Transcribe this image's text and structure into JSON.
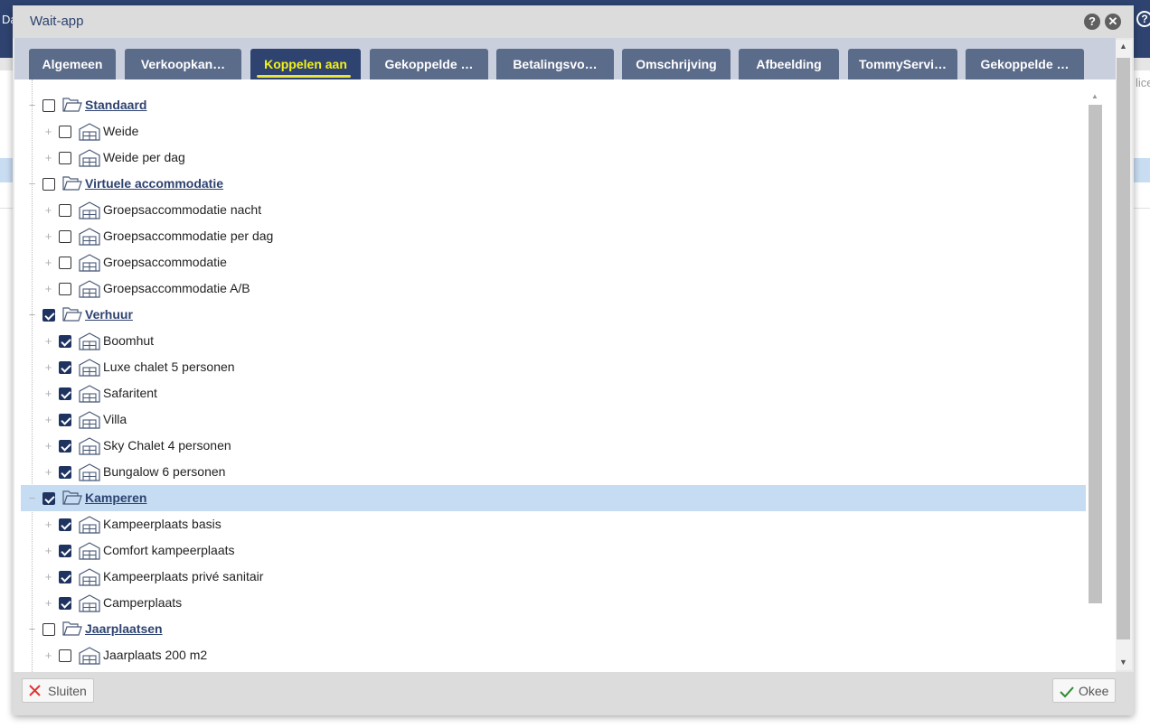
{
  "background": {
    "left_text": "Da",
    "right_text": "lice",
    "help_glyph": "?"
  },
  "dialog": {
    "title": "Wait-app",
    "help_glyph": "?",
    "close_glyph": "✕"
  },
  "tabs": [
    {
      "label": "Algemeen"
    },
    {
      "label": "Verkoopkan…"
    },
    {
      "label": "Koppelen aan",
      "active": true
    },
    {
      "label": "Gekoppelde …"
    },
    {
      "label": "Betalingsvo…"
    },
    {
      "label": "Omschrijving"
    },
    {
      "label": "Afbeelding"
    },
    {
      "label": "TommyServi…"
    },
    {
      "label": "Gekoppelde …"
    }
  ],
  "tree": [
    {
      "label": "Standaard",
      "group": true,
      "checked": false,
      "icon": "folder-open-icon"
    },
    {
      "label": "Weide",
      "group": false,
      "checked": false,
      "icon": "accommodation-icon"
    },
    {
      "label": "Weide per dag",
      "group": false,
      "checked": false,
      "icon": "accommodation-icon"
    },
    {
      "label": "Virtuele accommodatie",
      "group": true,
      "checked": false,
      "icon": "folder-open-icon"
    },
    {
      "label": "Groepsaccommodatie nacht",
      "group": false,
      "checked": false,
      "icon": "accommodation-icon"
    },
    {
      "label": "Groepsaccommodatie per dag",
      "group": false,
      "checked": false,
      "icon": "accommodation-icon"
    },
    {
      "label": "Groepsaccommodatie",
      "group": false,
      "checked": false,
      "icon": "accommodation-icon"
    },
    {
      "label": "Groepsaccommodatie A/B",
      "group": false,
      "checked": false,
      "icon": "accommodation-icon"
    },
    {
      "label": "Verhuur",
      "group": true,
      "checked": true,
      "icon": "folder-open-icon"
    },
    {
      "label": "Boomhut",
      "group": false,
      "checked": true,
      "icon": "accommodation-icon"
    },
    {
      "label": "Luxe chalet 5 personen",
      "group": false,
      "checked": true,
      "icon": "accommodation-icon"
    },
    {
      "label": "Safaritent",
      "group": false,
      "checked": true,
      "icon": "accommodation-icon"
    },
    {
      "label": "Villa",
      "group": false,
      "checked": true,
      "icon": "accommodation-icon"
    },
    {
      "label": "Sky Chalet 4 personen",
      "group": false,
      "checked": true,
      "icon": "accommodation-icon"
    },
    {
      "label": "Bungalow 6 personen",
      "group": false,
      "checked": true,
      "icon": "accommodation-icon"
    },
    {
      "label": "Kamperen",
      "group": true,
      "checked": true,
      "selected": true,
      "icon": "folder-open-icon"
    },
    {
      "label": "Kampeerplaats basis",
      "group": false,
      "checked": true,
      "icon": "accommodation-icon"
    },
    {
      "label": "Comfort kampeerplaats",
      "group": false,
      "checked": true,
      "icon": "accommodation-icon"
    },
    {
      "label": "Kampeerplaats privé sanitair",
      "group": false,
      "checked": true,
      "icon": "accommodation-icon"
    },
    {
      "label": "Camperplaats",
      "group": false,
      "checked": true,
      "icon": "accommodation-icon"
    },
    {
      "label": "Jaarplaatsen",
      "group": true,
      "checked": false,
      "icon": "folder-open-icon"
    },
    {
      "label": "Jaarplaats 200 m2",
      "group": false,
      "checked": false,
      "icon": "accommodation-icon"
    }
  ],
  "footer": {
    "close_label": "Sluiten",
    "ok_label": "Okee"
  },
  "colors": {
    "header_bg": "#2e4370",
    "tab_bg": "#5b6b8a",
    "tab_active_bg": "#2e4370",
    "tab_active_text": "#f5f11a",
    "selected_row_bg": "#c5dcf2",
    "checkbox_checked": "#1f3361"
  }
}
